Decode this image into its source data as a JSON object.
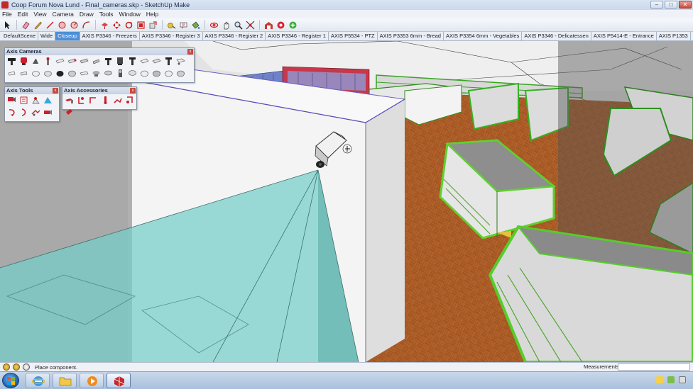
{
  "window": {
    "title": "Coop Forum Nova Lund - Final_cameras.skp - SketchUp Make",
    "minimize_label": "–",
    "maximize_label": "□",
    "close_label": "✕"
  },
  "menu": {
    "items": [
      "File",
      "Edit",
      "View",
      "Camera",
      "Draw",
      "Tools",
      "Window",
      "Help"
    ]
  },
  "toolbar": {
    "tools": [
      "select-icon",
      "eraser-icon",
      "pencil-icon",
      "line-icon",
      "circle-icon",
      "arc-icon",
      "shape-icon",
      "push-pull-icon",
      "move-icon",
      "rotate-icon",
      "offset-icon",
      "scale-icon",
      "tape-measure-icon",
      "text-icon",
      "paint-bucket-icon",
      "orbit-icon",
      "pan-icon",
      "zoom-icon",
      "zoom-extents-icon",
      "warehouse-icon",
      "components-icon",
      "extension-icon"
    ]
  },
  "scenes": {
    "active_index": 2,
    "tabs": [
      "DefaultScene",
      "Wide",
      "Closeup",
      "AXIS P3346 - Freezers",
      "AXIS P3346 - Register 3",
      "AXIS P3346 - Register 2",
      "AXIS P3346 - Register 1",
      "AXIS P5534 - PTZ",
      "AXIS P3353 6mm - Bread",
      "AXIS P3354 6mm - Vegetables",
      "AXIS P3346 - Delicatessen",
      "AXIS P5414-E - Entrance",
      "AXIS P1353"
    ]
  },
  "palettes": {
    "cameras": {
      "title": "Axis Cameras",
      "close": "x"
    },
    "tools": {
      "title": "Axis Tools",
      "close": "x"
    },
    "accessories": {
      "title": "Axis Accessories",
      "close": "x"
    }
  },
  "status": {
    "hint": "Place component.",
    "measurements_label": "Measurements",
    "measurements_value": ""
  },
  "colors": {
    "accent": "#4d8fd6",
    "axis_red": "#c8202e",
    "fov_cyan": "#7fd3cf",
    "floor_wood": "#b5622b",
    "shelf_green": "#5fd12a"
  }
}
